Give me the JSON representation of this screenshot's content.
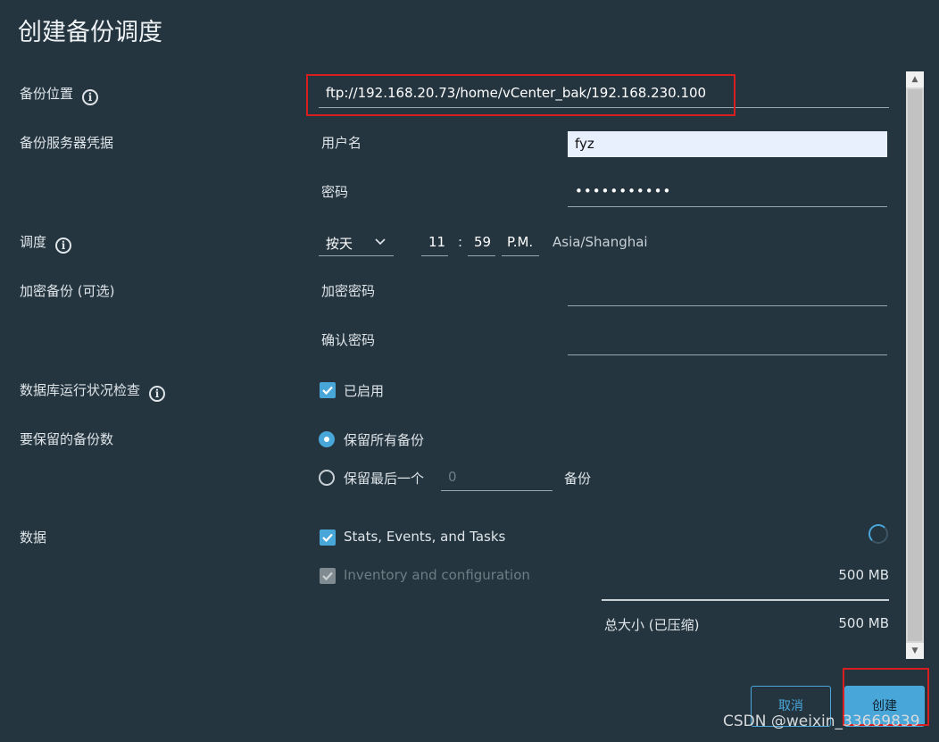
{
  "dialog": {
    "title": "创建备份调度"
  },
  "fields": {
    "location": {
      "label": "备份位置",
      "value": "ftp://192.168.20.73/home/vCenter_bak/192.168.230.100"
    },
    "credentials": {
      "label": "备份服务器凭据",
      "username_label": "用户名",
      "username_value": "fyz",
      "password_label": "密码",
      "password_value": "•••••••••••"
    },
    "schedule": {
      "label": "调度",
      "frequency": "按天",
      "hour": "11",
      "separator": ":",
      "minute": "59",
      "ampm": "P.M.",
      "timezone": "Asia/Shanghai"
    },
    "encryption": {
      "label": "加密备份 (可选)",
      "password_label": "加密密码",
      "confirm_label": "确认密码"
    },
    "db_health": {
      "label": "数据库运行状况检查",
      "checkbox_label": "已启用",
      "checked": true
    },
    "retention": {
      "label": "要保留的备份数",
      "keep_all_label": "保留所有备份",
      "keep_last_label": "保留最后一个",
      "keep_last_placeholder": "0",
      "keep_last_suffix": "备份",
      "selected": "keep_all"
    },
    "data": {
      "label": "数据",
      "items": [
        {
          "label": "Stats, Events, and Tasks",
          "checked": true,
          "disabled": false,
          "size": ""
        },
        {
          "label": "Inventory and configuration",
          "checked": true,
          "disabled": true,
          "size": "500 MB"
        }
      ],
      "total_label": "总大小 (已压缩)",
      "total_value": "500 MB"
    }
  },
  "buttons": {
    "cancel": "取消",
    "create": "创建"
  },
  "watermark": "CSDN @weixin_33669839",
  "colors": {
    "background": "#243540",
    "accent": "#49a6d9",
    "highlight": "#d81e1e"
  }
}
